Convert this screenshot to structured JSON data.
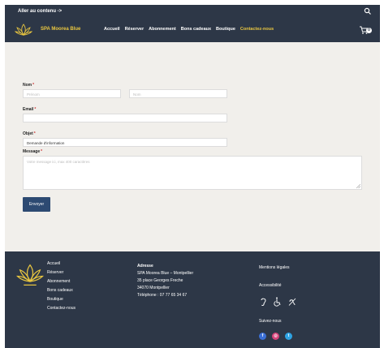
{
  "topbar": {
    "skip_link": "Aller au contenu ->"
  },
  "header": {
    "brand": "SPA Moorea Blue",
    "nav": [
      "Accueil",
      "Réserver",
      "Abonnement",
      "Bons cadeaux",
      "Boutique",
      "Contactez-nous"
    ],
    "active_nav_index": 5,
    "cart_count": "0",
    "colors": {
      "bar": "#2d3747",
      "accent": "#e9c640"
    }
  },
  "form": {
    "name_label": "Nom",
    "first_name_placeholder": "Prénom",
    "last_name_placeholder": "Nom",
    "email_label": "Email",
    "subject_label": "Objet",
    "subject_value": "Demande d'information",
    "message_label": "Message",
    "message_placeholder": "Votre message ici, max 400 caractères",
    "required_mark": "*",
    "submit_label": "Envoyer",
    "colors": {
      "background": "#f1efeb",
      "button": "#2d4a72"
    }
  },
  "footer": {
    "links": [
      "Accueil",
      "Réserver",
      "Abonnement",
      "Bons cadeaux",
      "Boutique",
      "Contactez-nous"
    ],
    "address_title": "Adresse",
    "address_lines": [
      "SPA Moorea Blue – Montpellier",
      "35 place Georges Freche",
      "34070 Montpellier",
      "Téléphone : 07 77 65 34 67"
    ],
    "legal": "Mentions légales",
    "accessibility": "Accessibilité",
    "follow": "Suivez-nous",
    "accessibility_icons": [
      "hearing-icon",
      "wheelchair-icon",
      "no-sound-icon"
    ],
    "social_icons": [
      "facebook-icon",
      "instagram-icon",
      "twitter-icon"
    ],
    "social_colors": {
      "facebook": "#3b6fd6",
      "instagram": "#d6437a",
      "twitter": "#2ea3e3"
    }
  }
}
